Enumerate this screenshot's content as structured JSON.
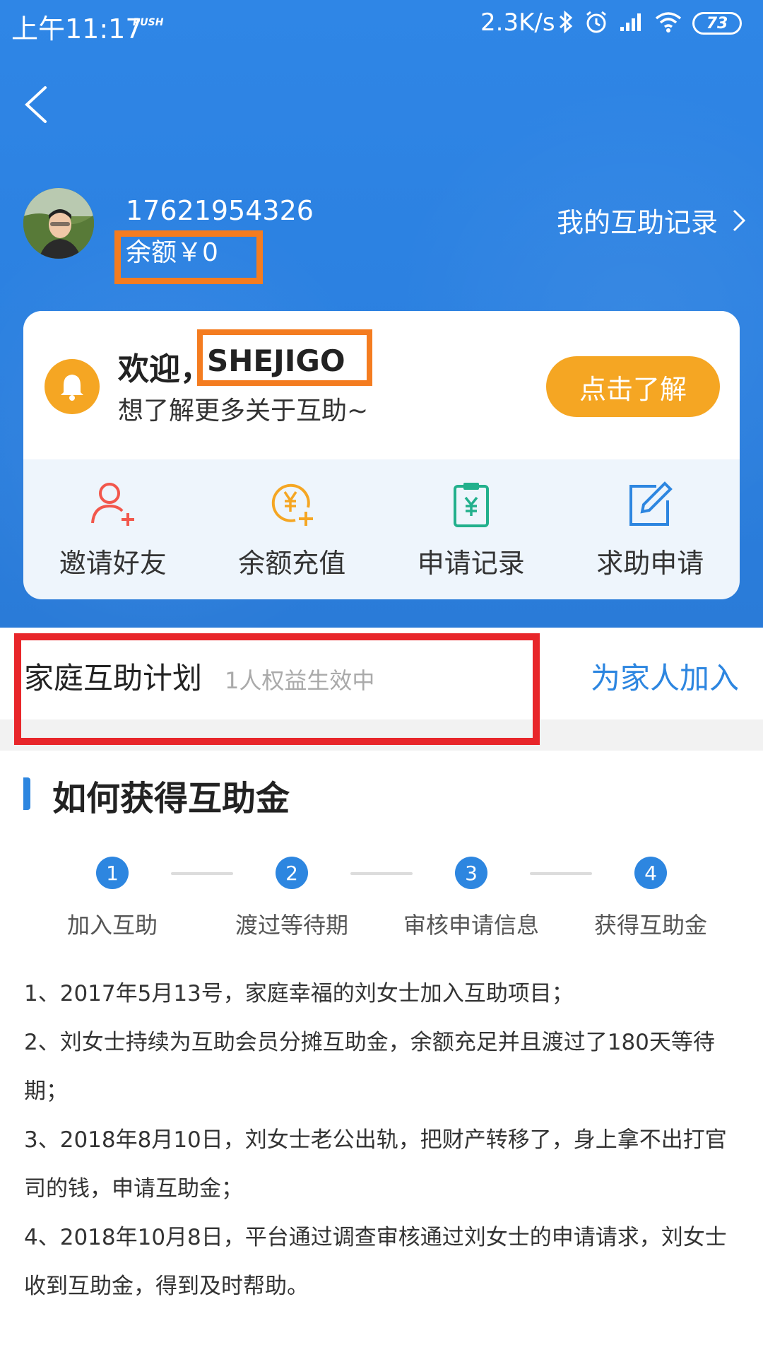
{
  "status_bar": {
    "time": "上午11:17",
    "push": "PUSH",
    "speed": "2.3K/s",
    "battery": "73"
  },
  "header": {
    "back_icon": "chevron-left-icon",
    "phone": "17621954326",
    "balance": "余额￥0",
    "records_link": "我的互助记录"
  },
  "welcome_card": {
    "greeting": "欢迎，",
    "name": "SHEJIGO",
    "subtitle": "想了解更多关于互助~",
    "button": "点击了解"
  },
  "actions": [
    {
      "label": "邀请好友",
      "icon": "add-user-icon",
      "color": "#f2574c"
    },
    {
      "label": "余额充值",
      "icon": "yen-coin-plus-icon",
      "color": "#f5a623"
    },
    {
      "label": "申请记录",
      "icon": "clipboard-yen-icon",
      "color": "#22b08c"
    },
    {
      "label": "求助申请",
      "icon": "edit-icon",
      "color": "#2d86e0"
    }
  ],
  "family_plan": {
    "title": "家庭互助计划",
    "status": "1人权益生效中",
    "join": "为家人加入"
  },
  "how_to": {
    "title": "如何获得互助金",
    "steps": [
      {
        "num": "1",
        "label": "加入互助"
      },
      {
        "num": "2",
        "label": "渡过等待期"
      },
      {
        "num": "3",
        "label": "审核申请信息"
      },
      {
        "num": "4",
        "label": "获得互助金"
      }
    ],
    "paragraphs": [
      "1、2017年5月13号，家庭幸福的刘女士加入互助项目；",
      "2、刘女士持续为互助会员分摊互助金，余额充足并且渡过了180天等待期；",
      "3、2018年8月10日，刘女士老公出轨，把财产转移了，身上拿不出打官司的钱，申请互助金；",
      "4、2018年10月8日，平台通过调查审核通过刘女士的申请请求，刘女士收到互助金，得到及时帮助。"
    ]
  },
  "colors": {
    "header_blue": "#2f86e6",
    "accent_blue": "#2d86e0",
    "orange": "#f5a623",
    "highlight_orange": "#f47c20",
    "highlight_red": "#e8262a"
  }
}
